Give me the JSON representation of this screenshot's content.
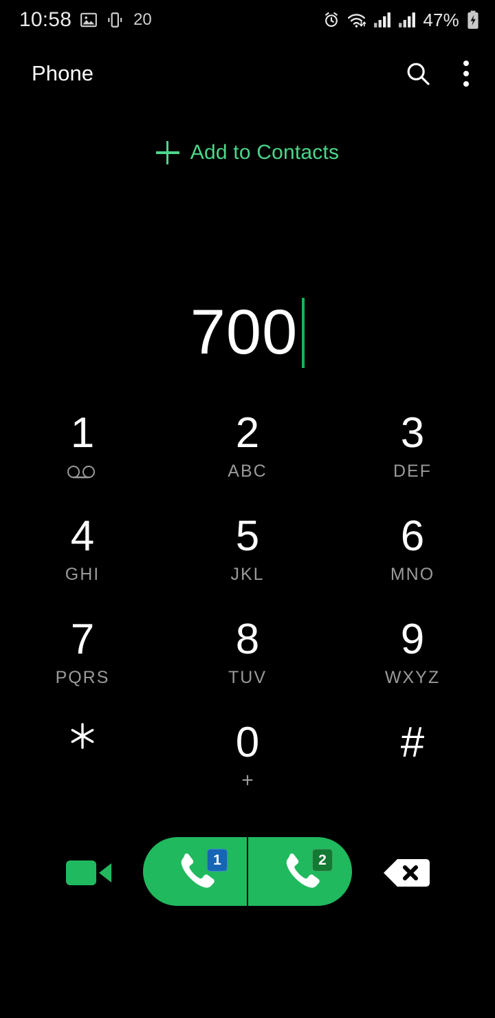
{
  "status_bar": {
    "time": "10:58",
    "notification_count": "20",
    "battery_percent": "47%",
    "icons": {
      "gallery": "image-icon",
      "vibrate": "vibrate-icon",
      "alarm": "alarm-icon",
      "wifi": "wifi-icon",
      "signal_sim1": "signal-bars-icon",
      "signal_sim2": "signal-bars-icon",
      "battery": "battery-charging-icon"
    }
  },
  "app_bar": {
    "title": "Phone",
    "search_icon": "search-icon",
    "overflow_icon": "more-vertical-icon"
  },
  "add_contacts": {
    "label": "Add to Contacts",
    "icon": "plus-icon"
  },
  "number_display": {
    "value": "700",
    "cursor_visible": true
  },
  "dialpad": {
    "keys": [
      {
        "digit": "1",
        "sub": "",
        "icon": "voicemail-icon"
      },
      {
        "digit": "2",
        "sub": "ABC",
        "icon": ""
      },
      {
        "digit": "3",
        "sub": "DEF",
        "icon": ""
      },
      {
        "digit": "4",
        "sub": "GHI",
        "icon": ""
      },
      {
        "digit": "5",
        "sub": "JKL",
        "icon": ""
      },
      {
        "digit": "6",
        "sub": "MNO",
        "icon": ""
      },
      {
        "digit": "7",
        "sub": "PQRS",
        "icon": ""
      },
      {
        "digit": "8",
        "sub": "TUV",
        "icon": ""
      },
      {
        "digit": "9",
        "sub": "WXYZ",
        "icon": ""
      },
      {
        "digit": "✳",
        "sub": "",
        "icon": ""
      },
      {
        "digit": "0",
        "sub": "+",
        "icon": ""
      },
      {
        "digit": "#",
        "sub": "",
        "icon": ""
      }
    ]
  },
  "bottom_bar": {
    "video_call_icon": "video-camera-icon",
    "call_sim1_icon": "phone-handset-icon",
    "call_sim1_badge": "1",
    "call_sim2_icon": "phone-handset-icon",
    "call_sim2_badge": "2",
    "backspace_icon": "backspace-icon"
  },
  "colors": {
    "background": "#000000",
    "accent_green": "#4dd68b",
    "call_green": "#20b95e",
    "cursor_green": "#18b259",
    "sim1_blue": "#1666b5",
    "sim2_green": "#137a33",
    "sub_label_gray": "#9a9a9a"
  }
}
